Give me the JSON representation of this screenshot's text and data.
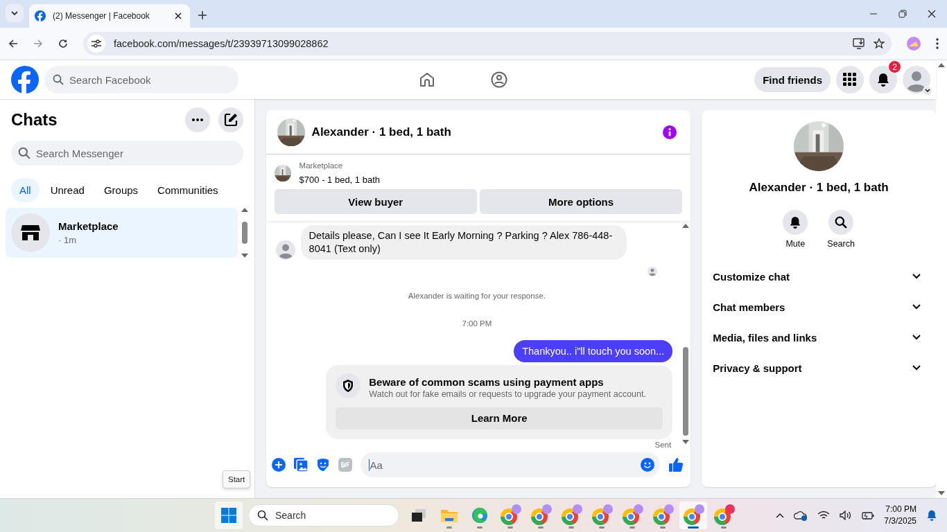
{
  "browser": {
    "tab": {
      "title": "(2) Messenger | Facebook",
      "selected": true
    },
    "url": "facebook.com/messages/t/23939713099028862"
  },
  "header": {
    "search_placeholder": "Search Facebook",
    "find_friends": "Find friends",
    "notification_count": "2"
  },
  "sidebar": {
    "title": "Chats",
    "search_placeholder": "Search Messenger",
    "filters": [
      {
        "label": "All",
        "selected": true
      },
      {
        "label": "Unread",
        "selected": false
      },
      {
        "label": "Groups",
        "selected": false
      },
      {
        "label": "Communities",
        "selected": false
      }
    ],
    "chats": [
      {
        "name": "Marketplace",
        "time": "· 1m",
        "selected": true
      }
    ]
  },
  "conversation": {
    "title": "Alexander · 1 bed, 1 bath",
    "listing": {
      "source": "Marketplace",
      "summary": "$700 - 1 bed, 1 bath"
    },
    "actions": [
      "View buyer",
      "More options"
    ],
    "messages": [
      {
        "kind": "incoming",
        "text": "Details please, Can I see It Early Morning ? Parking ? Alex 786-448-8041 (Text only)"
      },
      {
        "kind": "notice",
        "text": "Alexander is waiting for your response."
      },
      {
        "kind": "timestamp",
        "text": "7:00 PM"
      },
      {
        "kind": "outgoing",
        "text": "Thankyou.. i\"ll touch you soon..."
      },
      {
        "kind": "alert",
        "title": "Beware of common scams using payment apps",
        "body": "Watch out for fake emails or requests to upgrade your payment account.",
        "button": "Learn More"
      },
      {
        "kind": "status",
        "text": "Sent"
      }
    ],
    "composer_placeholder": "Aa"
  },
  "details": {
    "name": "Alexander · 1 bed, 1 bath",
    "actions": [
      "Mute",
      "Search"
    ],
    "sections": [
      {
        "label": "Customize chat",
        "expanded": false
      },
      {
        "label": "Chat members",
        "expanded": false
      },
      {
        "label": "Media, files and links",
        "expanded": false
      },
      {
        "label": "Privacy & support",
        "expanded": false
      }
    ]
  },
  "tooltip": "Start",
  "taskbar": {
    "search_placeholder": "Search",
    "apps": [
      {
        "kind": "files",
        "active": false
      },
      {
        "kind": "edge",
        "active": false
      },
      {
        "kind": "chrome",
        "active": false
      },
      {
        "kind": "chrome",
        "active": false
      },
      {
        "kind": "chrome",
        "active": false
      },
      {
        "kind": "chrome",
        "active": false
      },
      {
        "kind": "chrome",
        "active": false
      },
      {
        "kind": "chrome",
        "active": false
      },
      {
        "kind": "chrome",
        "active": true
      },
      {
        "kind": "chrome-z",
        "active": false
      }
    ],
    "time": "7:00 PM",
    "date": "7/3/2025"
  }
}
